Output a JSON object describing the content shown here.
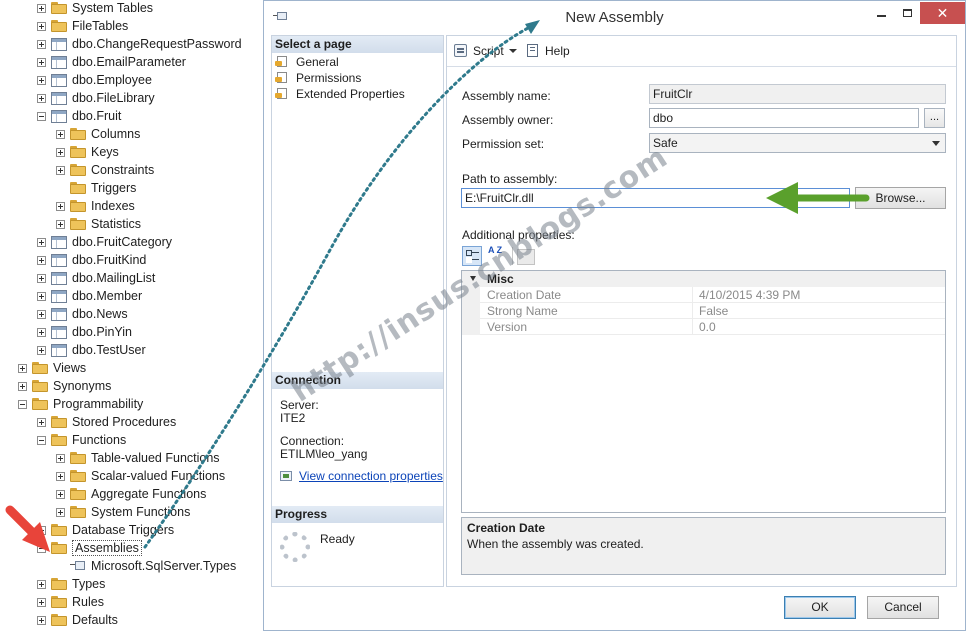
{
  "tree": {
    "items": [
      {
        "label": "System Tables",
        "icon": "folder",
        "expander": "plus",
        "indent": 1
      },
      {
        "label": "FileTables",
        "icon": "folder",
        "expander": "plus",
        "indent": 1
      },
      {
        "label": "dbo.ChangeRequestPassword",
        "icon": "table",
        "expander": "plus",
        "indent": 1
      },
      {
        "label": "dbo.EmailParameter",
        "icon": "table",
        "expander": "plus",
        "indent": 1
      },
      {
        "label": "dbo.Employee",
        "icon": "table",
        "expander": "plus",
        "indent": 1
      },
      {
        "label": "dbo.FileLibrary",
        "icon": "table",
        "expander": "plus",
        "indent": 1
      },
      {
        "label": "dbo.Fruit",
        "icon": "table",
        "expander": "minus",
        "indent": 1
      },
      {
        "label": "Columns",
        "icon": "folder",
        "expander": "plus",
        "indent": 2
      },
      {
        "label": "Keys",
        "icon": "folder",
        "expander": "plus",
        "indent": 2
      },
      {
        "label": "Constraints",
        "icon": "folder",
        "expander": "plus",
        "indent": 2
      },
      {
        "label": "Triggers",
        "icon": "folder",
        "expander": "none",
        "indent": 2
      },
      {
        "label": "Indexes",
        "icon": "folder",
        "expander": "plus",
        "indent": 2
      },
      {
        "label": "Statistics",
        "icon": "folder",
        "expander": "plus",
        "indent": 2
      },
      {
        "label": "dbo.FruitCategory",
        "icon": "table",
        "expander": "plus",
        "indent": 1
      },
      {
        "label": "dbo.FruitKind",
        "icon": "table",
        "expander": "plus",
        "indent": 1
      },
      {
        "label": "dbo.MailingList",
        "icon": "table",
        "expander": "plus",
        "indent": 1
      },
      {
        "label": "dbo.Member",
        "icon": "table",
        "expander": "plus",
        "indent": 1
      },
      {
        "label": "dbo.News",
        "icon": "table",
        "expander": "plus",
        "indent": 1
      },
      {
        "label": "dbo.PinYin",
        "icon": "table",
        "expander": "plus",
        "indent": 1
      },
      {
        "label": "dbo.TestUser",
        "icon": "table",
        "expander": "plus",
        "indent": 1
      },
      {
        "label": "Views",
        "icon": "folder",
        "expander": "plus",
        "indent": 0
      },
      {
        "label": "Synonyms",
        "icon": "folder",
        "expander": "plus",
        "indent": 0
      },
      {
        "label": "Programmability",
        "icon": "folder",
        "expander": "minus",
        "indent": 0
      },
      {
        "label": "Stored Procedures",
        "icon": "folder",
        "expander": "plus",
        "indent": 1
      },
      {
        "label": "Functions",
        "icon": "folder",
        "expander": "minus",
        "indent": 1
      },
      {
        "label": "Table-valued Functions",
        "icon": "folder",
        "expander": "plus",
        "indent": 2
      },
      {
        "label": "Scalar-valued Functions",
        "icon": "folder",
        "expander": "plus",
        "indent": 2
      },
      {
        "label": "Aggregate Functions",
        "icon": "folder",
        "expander": "plus",
        "indent": 2
      },
      {
        "label": "System Functions",
        "icon": "folder",
        "expander": "plus",
        "indent": 2
      },
      {
        "label": "Database Triggers",
        "icon": "folder",
        "expander": "plus",
        "indent": 1
      },
      {
        "label": "Assemblies",
        "icon": "folder",
        "expander": "minus",
        "indent": 1
      },
      {
        "label": "Microsoft.SqlServer.Types",
        "icon": "assembly",
        "expander": "none",
        "indent": 2
      },
      {
        "label": "Types",
        "icon": "folder",
        "expander": "plus",
        "indent": 1
      },
      {
        "label": "Rules",
        "icon": "folder",
        "expander": "plus",
        "indent": 1
      },
      {
        "label": "Defaults",
        "icon": "folder",
        "expander": "plus",
        "indent": 1
      }
    ]
  },
  "dialog": {
    "title": "New Assembly",
    "window_buttons": {
      "close": "✕"
    },
    "select_page": {
      "header": "Select a page",
      "pages": [
        "General",
        "Permissions",
        "Extended Properties"
      ]
    },
    "connection": {
      "header": "Connection",
      "server_label": "Server:",
      "server_value": "ITE2",
      "connection_label": "Connection:",
      "connection_value": "ETILM\\leo_yang",
      "view_link": "View connection properties"
    },
    "progress": {
      "header": "Progress",
      "status": "Ready"
    },
    "toolbar": {
      "script_label": "Script",
      "help_label": "Help"
    },
    "form": {
      "assembly_name_label": "Assembly name:",
      "assembly_name_value": "FruitClr",
      "assembly_owner_label": "Assembly owner:",
      "assembly_owner_value": "dbo",
      "owner_browse_label": "...",
      "permission_set_label": "Permission set:",
      "permission_set_value": "Safe",
      "path_label": "Path to assembly:",
      "path_value": "E:\\FruitClr.dll",
      "browse_label": "Browse...",
      "additional_label": "Additional properties:"
    },
    "property_grid": {
      "category": "Misc",
      "rows": [
        {
          "name": "Creation Date",
          "value": "4/10/2015 4:39 PM"
        },
        {
          "name": "Strong Name",
          "value": "False"
        },
        {
          "name": "Version",
          "value": "0.0"
        }
      ],
      "alpha_glyph": "A Z",
      "description_title": "Creation Date",
      "description_text": "When the assembly was created."
    },
    "buttons": {
      "ok": "OK",
      "cancel": "Cancel"
    }
  },
  "annotations": {
    "watermark": "http://insus.cnblogs.com",
    "arrow_colors": {
      "red": "#e8443a",
      "green": "#5aa02c",
      "dotted": "#2f7a8c"
    }
  }
}
